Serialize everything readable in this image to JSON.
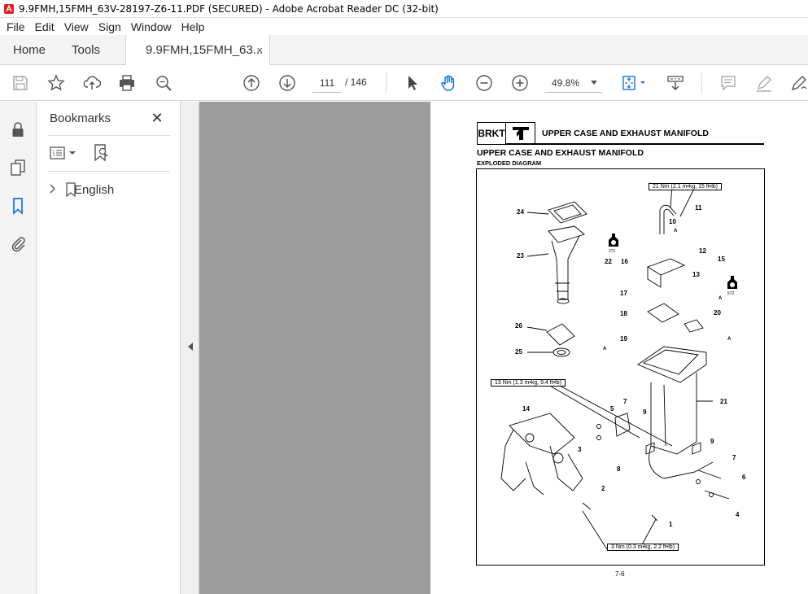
{
  "window": {
    "title": "9.9FMH,15FMH_63V-28197-Z6-11.PDF (SECURED) - Adobe Acrobat Reader DC (32-bit)"
  },
  "menu": [
    "File",
    "Edit",
    "View",
    "Sign",
    "Window",
    "Help"
  ],
  "tabs": {
    "home": "Home",
    "tools": "Tools",
    "document": "9.9FMH,15FMH_63...",
    "close_glyph": "×"
  },
  "toolbar": {
    "current_page": "111",
    "page_total": "/ 146",
    "zoom": "49.8%"
  },
  "bookmarks": {
    "title": "Bookmarks",
    "close_glyph": "✕",
    "items": [
      {
        "label": "English",
        "expander": "›"
      }
    ]
  },
  "document_page": {
    "header_code": "BRKT",
    "header_title": "UPPER CASE AND EXHAUST MANIFOLD",
    "section_title": "UPPER CASE AND EXHAUST MANIFOLD",
    "section_subtitle": "EXPLODED DIAGRAM",
    "torque_callouts": [
      "21 Nm (2.1 m•kg, 15 ft•lb)",
      "13 Nm (1.3 m•kg, 9.4 ft•lb)",
      "3 Nm (0.3 m•kg, 2.2 ft•lb)"
    ],
    "part_numbers": [
      "24",
      "23",
      "22",
      "26",
      "25",
      "14",
      "5",
      "7",
      "9",
      "3",
      "8",
      "2",
      "1",
      "11",
      "10",
      "12",
      "16",
      "13",
      "15",
      "17",
      "18",
      "19",
      "20",
      "21",
      "9",
      "7",
      "6",
      "4"
    ],
    "sealant_labels": [
      "271",
      "572"
    ],
    "grease_label": "A",
    "page_number": "7-6"
  },
  "colors": {
    "accent": "#1473e6",
    "doc_background": "#9c9c9c",
    "pdf_icon": "#e02020"
  }
}
